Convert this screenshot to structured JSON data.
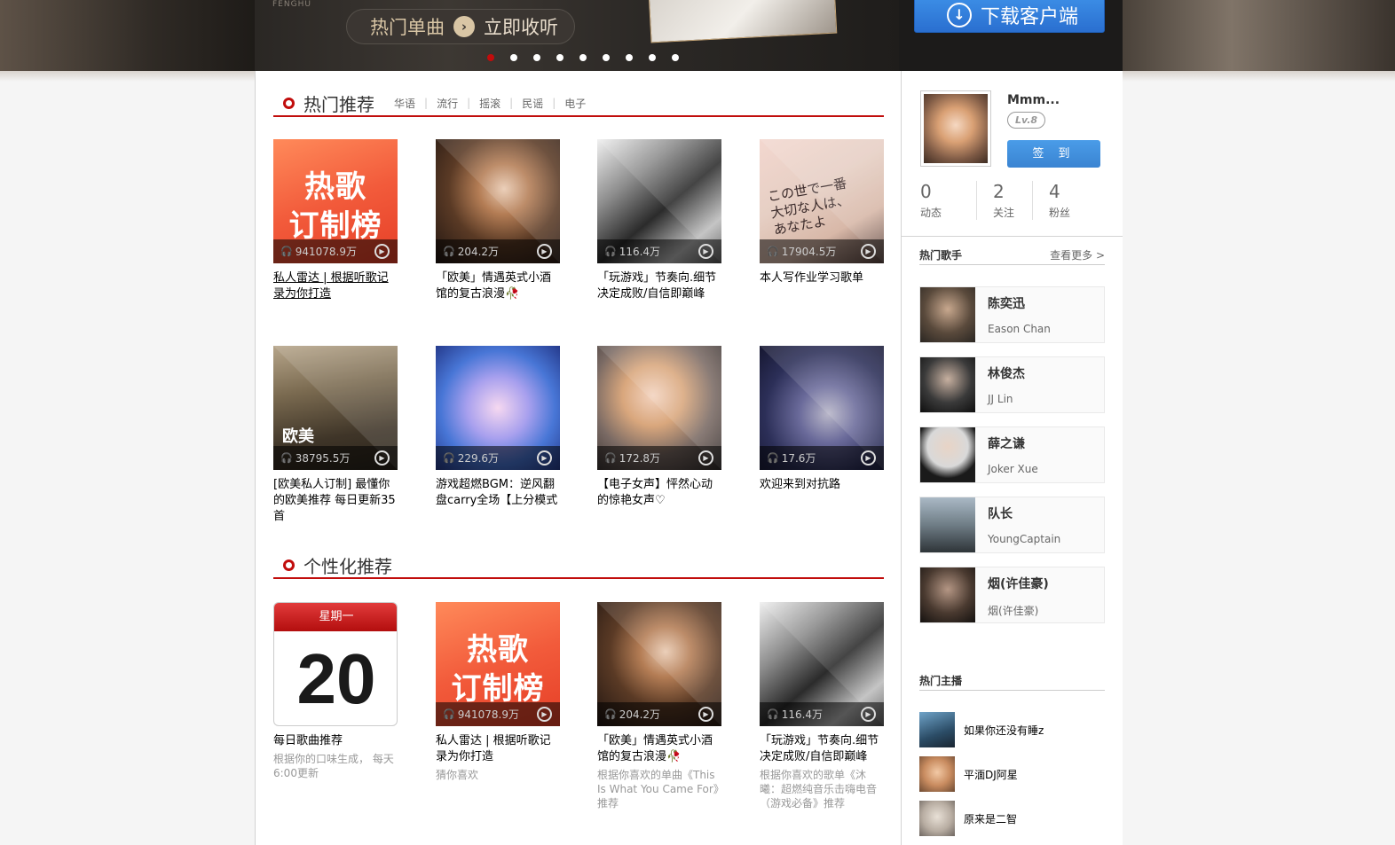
{
  "banner": {
    "vertical_text": "FENGHU",
    "pill_label": "热门单曲",
    "pill_action": "立即收听",
    "dots_count": 9,
    "active_dot": 0,
    "download_label": "下载客户端"
  },
  "hot": {
    "title": "热门推荐",
    "tags": [
      "华语",
      "流行",
      "摇滚",
      "民谣",
      "电子"
    ],
    "items": [
      {
        "plays": "941078.9万",
        "title": "私人雷达 | 根据听歌记录为你打造",
        "cover": "hot-chart"
      },
      {
        "plays": "204.2万",
        "title": "「欧美」情遇英式小酒馆的复古浪漫🥀",
        "cover": "girl-portrait"
      },
      {
        "plays": "116.4万",
        "title": "「玩游戏」节奏向.细节决定成败/自信即巅峰",
        "cover": "bw-illustration"
      },
      {
        "plays": "17904.5万",
        "title": "本人写作业学习歌单",
        "cover": "note-clipboard"
      },
      {
        "plays": "38795.5万",
        "title": "[欧美私人订制] 最懂你的欧美推荐 每日更新35首",
        "cover": "band-stage"
      },
      {
        "plays": "229.6万",
        "title": "游戏超燃BGM：逆风翻盘carry全场【上分模式",
        "cover": "fox-girl"
      },
      {
        "plays": "172.8万",
        "title": "【电子女声】怦然心动的惊艳女声♡",
        "cover": "blonde-girl"
      },
      {
        "plays": "17.6万",
        "title": "欢迎来到对抗路",
        "cover": "blue-hair"
      }
    ],
    "hot_cover_line1": "热歌",
    "hot_cover_line2": "订制榜",
    "band_cover_word": "欧美",
    "note_cover_text": "この世で一番大切な人は、あなたよ"
  },
  "personal": {
    "title": "个性化推荐",
    "items": [
      {
        "title": "每日歌曲推荐",
        "sub": "根据你的口味生成，  每天6:00更新",
        "cover": "calendar",
        "weekday": "星期一",
        "day": "20"
      },
      {
        "plays": "941078.9万",
        "title": "私人雷达 | 根据听歌记录为你打造",
        "sub": "猜你喜欢",
        "cover": "hot-chart"
      },
      {
        "plays": "204.2万",
        "title": "「欧美」情遇英式小酒馆的复古浪漫🥀",
        "sub": "根据你喜欢的单曲《This Is What You Came For》推荐",
        "cover": "girl-portrait"
      },
      {
        "plays": "116.4万",
        "title": "「玩游戏」节奏向.细节决定成败/自信即巅峰",
        "sub": "根据你喜欢的歌单《沐曦：超燃纯音乐击嗨电音（游戏必备》推荐",
        "cover": "bw-illustration"
      }
    ]
  },
  "profile": {
    "name": "Mmm...",
    "level": "Lv.8",
    "signin_label": "签 到",
    "stats": [
      {
        "value": "0",
        "label": "动态"
      },
      {
        "value": "2",
        "label": "关注"
      },
      {
        "value": "4",
        "label": "粉丝"
      }
    ]
  },
  "singers": {
    "title": "热门歌手",
    "more": "查看更多 >",
    "items": [
      {
        "name": "陈奕迅",
        "en": "Eason Chan"
      },
      {
        "name": "林俊杰",
        "en": "JJ Lin"
      },
      {
        "name": "薛之谦",
        "en": "Joker Xue"
      },
      {
        "name": "队长",
        "en": "YoungCaptain"
      },
      {
        "name": "烟(许佳豪)",
        "en": "烟(许佳豪)"
      }
    ]
  },
  "anchors": {
    "title": "热门主播",
    "items": [
      {
        "name": "如果你还没有睡z"
      },
      {
        "name": "平湎DJ阿星"
      },
      {
        "name": "原来是二智"
      }
    ]
  },
  "colors": {
    "accent": "#c10d0c",
    "download": "#2a6fd0",
    "signin": "#3a84d2"
  }
}
